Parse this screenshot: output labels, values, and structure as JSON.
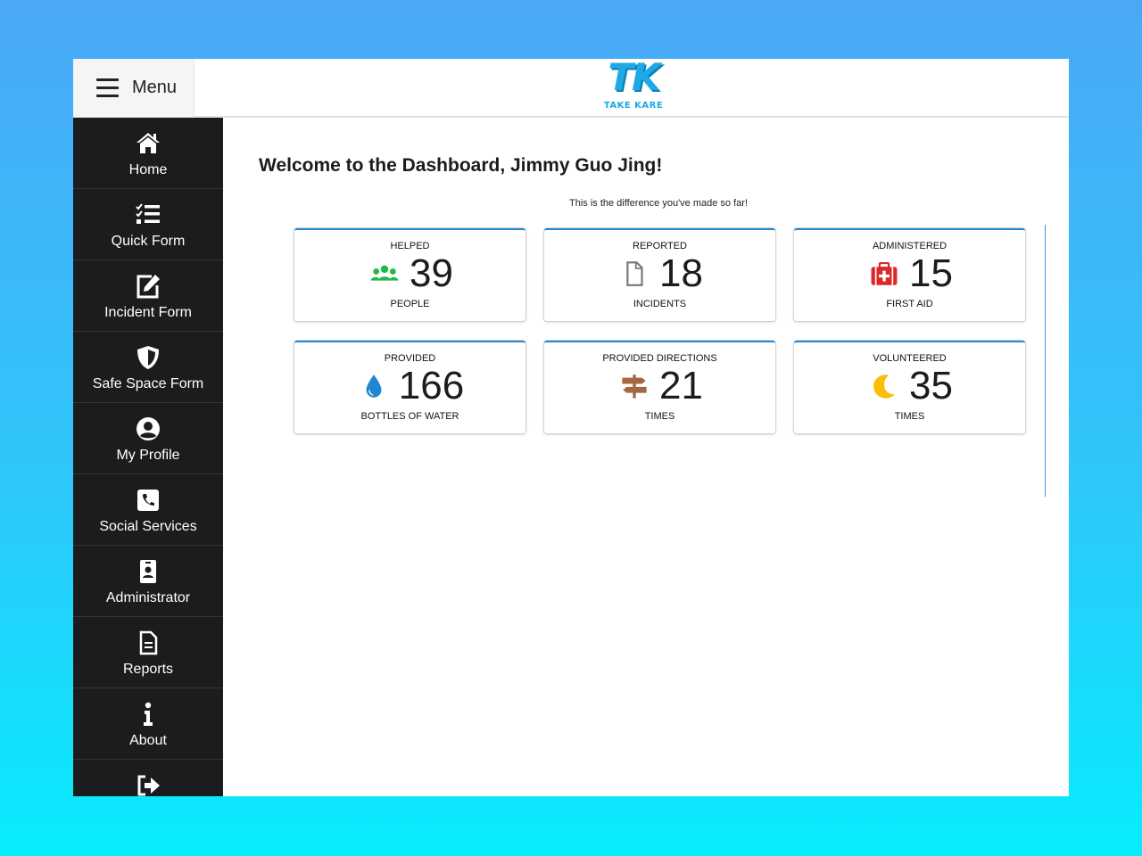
{
  "header": {
    "menu_label": "Menu",
    "logo_mark": "TK",
    "logo_subtitle": "TAKE KARE"
  },
  "sidebar": {
    "items": [
      {
        "label": "Home",
        "icon": "home-icon"
      },
      {
        "label": "Quick Form",
        "icon": "tasks-icon"
      },
      {
        "label": "Incident Form",
        "icon": "edit-icon"
      },
      {
        "label": "Safe Space Form",
        "icon": "shield-icon"
      },
      {
        "label": "My Profile",
        "icon": "user-circle-icon"
      },
      {
        "label": "Social Services",
        "icon": "phone-icon"
      },
      {
        "label": "Administrator",
        "icon": "id-badge-icon"
      },
      {
        "label": "Reports",
        "icon": "file-alt-icon"
      },
      {
        "label": "About",
        "icon": "info-icon"
      },
      {
        "label": "",
        "icon": "sign-out-icon"
      }
    ]
  },
  "main": {
    "welcome": "Welcome to the Dashboard, Jimmy Guo Jing!",
    "subtitle": "This is the difference you've made so far!",
    "stats": [
      {
        "label": "HELPED",
        "value": "39",
        "unit": "PEOPLE",
        "icon": "users-icon",
        "color": "#21ba45"
      },
      {
        "label": "REPORTED",
        "value": "18",
        "unit": "INCIDENTS",
        "icon": "file-outline-icon",
        "color": "#767676"
      },
      {
        "label": "ADMINISTERED",
        "value": "15",
        "unit": "FIRST AID",
        "icon": "first-aid-kit-icon",
        "color": "#db2828"
      },
      {
        "label": "PROVIDED",
        "value": "166",
        "unit": "BOTTLES OF WATER",
        "icon": "water-drop-icon",
        "color": "#2185d0"
      },
      {
        "label": "PROVIDED DIRECTIONS",
        "value": "21",
        "unit": "TIMES",
        "icon": "signpost-icon",
        "color": "#a5673f"
      },
      {
        "label": "VOLUNTEERED",
        "value": "35",
        "unit": "TIMES",
        "icon": "moon-icon",
        "color": "#fbbd08"
      }
    ]
  }
}
